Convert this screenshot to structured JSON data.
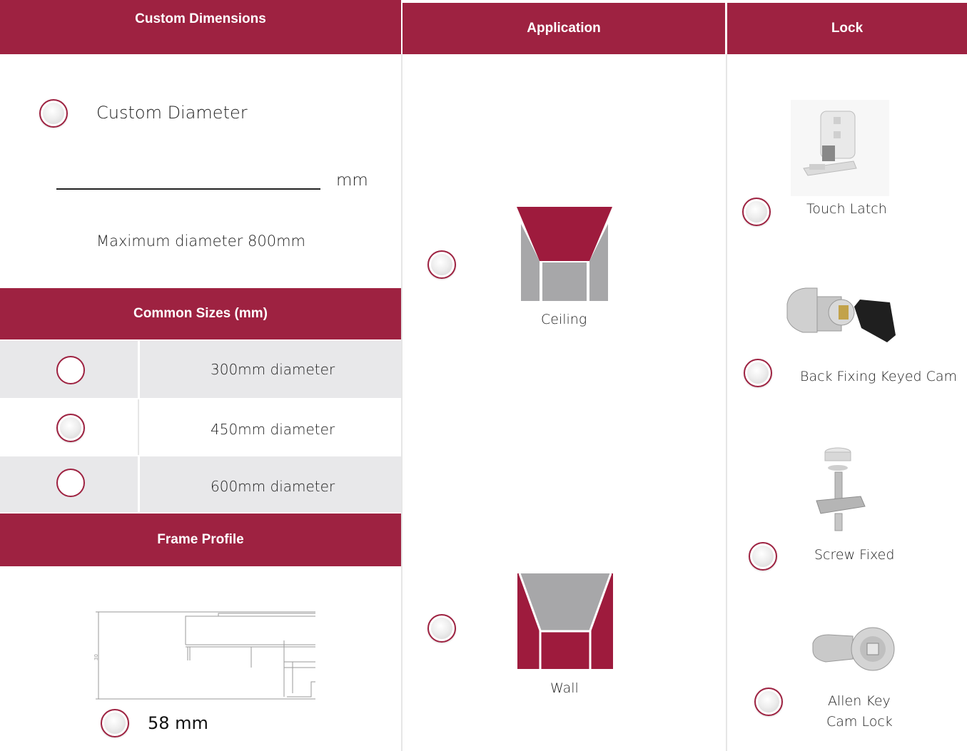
{
  "headers": {
    "custom_dimensions": "Custom Dimensions",
    "application": "Application",
    "lock": "Lock",
    "common_sizes": "Common Sizes (mm)",
    "frame_profile": "Frame Profile"
  },
  "custom": {
    "option_label": "Custom Diameter",
    "input_value": "",
    "unit": "mm",
    "note": "Maximum diameter 800mm"
  },
  "sizes": [
    {
      "label": "300mm diameter"
    },
    {
      "label": "450mm diameter"
    },
    {
      "label": "600mm diameter"
    }
  ],
  "frame": {
    "dimension_mark": "30",
    "option_label": "58 mm"
  },
  "application": {
    "ceiling_label": "Ceiling",
    "wall_label": "Wall"
  },
  "locks": [
    {
      "label": "Touch Latch",
      "icon": "touch-latch-icon"
    },
    {
      "label": "Back Fixing Keyed Cam",
      "icon": "keyed-cam-lock-icon"
    },
    {
      "label": "Screw Fixed",
      "icon": "screw-fixed-icon"
    },
    {
      "label_line1": "Allen Key",
      "label_line2": "Cam Lock",
      "icon": "allen-key-cam-lock-icon"
    }
  ],
  "colors": {
    "accent": "#9e2241",
    "row_grey": "#e8e8ea",
    "panel_grey": "#a8a8a8"
  }
}
